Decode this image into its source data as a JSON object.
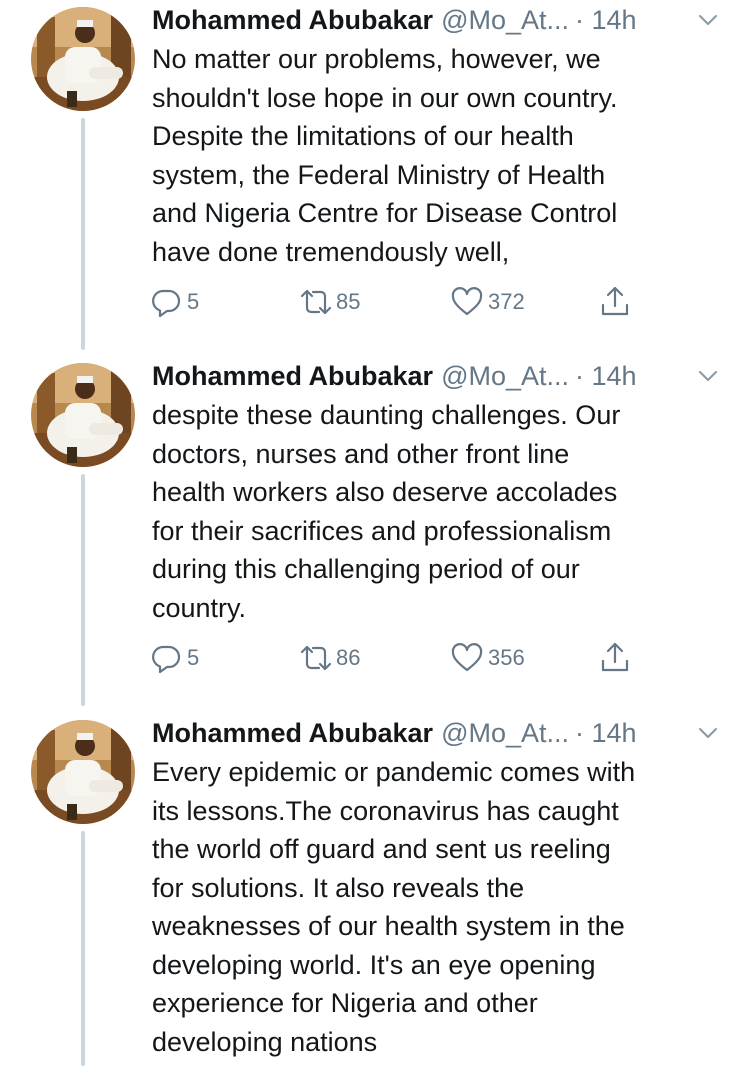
{
  "tweets": [
    {
      "name": "Mohammed Abubakar",
      "handle": "@Mo_At...",
      "time": "· 14h",
      "text": "No matter our problems, however,  we\nshouldn't lose hope in our own country.\nDespite the limitations of our health\nsystem, the Federal Ministry of Health\nand Nigeria Centre for Disease Control\nhave done tremendously well,",
      "replies": "5",
      "retweets": "85",
      "likes": "372"
    },
    {
      "name": "Mohammed Abubakar",
      "handle": "@Mo_At...",
      "time": "· 14h",
      "text": "despite these daunting challenges. Our\ndoctors, nurses and other front line\nhealth workers also deserve accolades\nfor their sacrifices and professionalism\nduring this challenging period of our\ncountry.",
      "replies": "5",
      "retweets": "86",
      "likes": "356"
    },
    {
      "name": "Mohammed Abubakar",
      "handle": "@Mo_At...",
      "time": "· 14h",
      "text": "Every epidemic or pandemic comes with\nits lessons.The coronavirus has caught\nthe world off guard and sent us reeling\nfor solutions. It also reveals the\nweaknesses of our health system in the\ndeveloping world. It's an eye opening\nexperience for Nigeria and other\ndeveloping nations"
    }
  ],
  "icons": {
    "reply": "reply-icon",
    "retweet": "retweet-icon",
    "like": "like-icon",
    "share": "share-icon",
    "menu": "chevron-down-icon",
    "avatar": "avatar"
  },
  "colors": {
    "text": "#14171a",
    "secondary": "#657786",
    "thread_line": "#ccd6dd",
    "background": "#ffffff"
  }
}
